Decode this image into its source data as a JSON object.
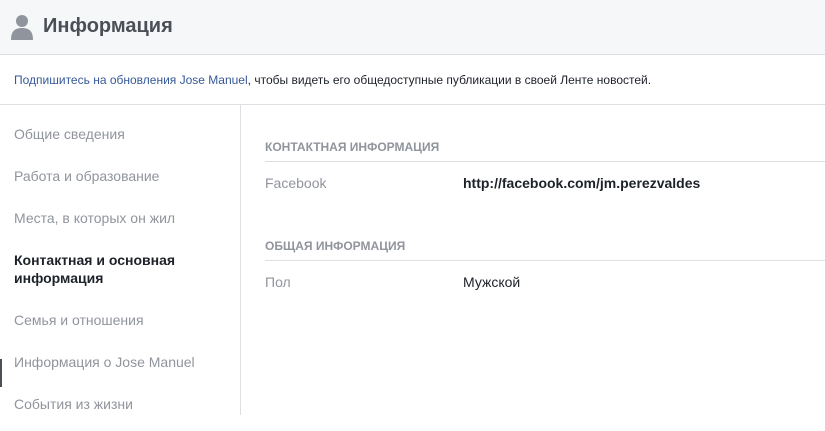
{
  "header": {
    "title": "Информация",
    "icon": "user-silhouette-icon"
  },
  "notice": {
    "prefix_link": "Подпишитесь на обновления Jose Manuel",
    "suffix": ", чтобы видеть его общедоступные публикации в своей Ленте новостей."
  },
  "sidebar": {
    "items": [
      {
        "label": "Общие сведения"
      },
      {
        "label": "Работа и образование"
      },
      {
        "label": "Места, в которых он жил"
      },
      {
        "label": "Контактная и основная информация",
        "line1": "Контактная и основная",
        "line2": "информация",
        "active": true
      },
      {
        "label": "Семья и отношения"
      },
      {
        "label": "Информация о Jose Manuel"
      },
      {
        "label": "События из жизни"
      }
    ]
  },
  "contact": {
    "title": "КОНТАКТНАЯ ИНФОРМАЦИЯ",
    "facebook_label": "Facebook",
    "facebook_value": "http://facebook.com/jm.perezvaldes"
  },
  "general": {
    "title": "ОБЩАЯ ИНФОРМАЦИЯ",
    "gender_label": "Пол",
    "gender_value": "Мужской"
  },
  "colors": {
    "link": "#365899",
    "muted": "#90949c",
    "text": "#1d2129",
    "header_bg": "#f6f7f9",
    "border": "#dddfe2"
  }
}
